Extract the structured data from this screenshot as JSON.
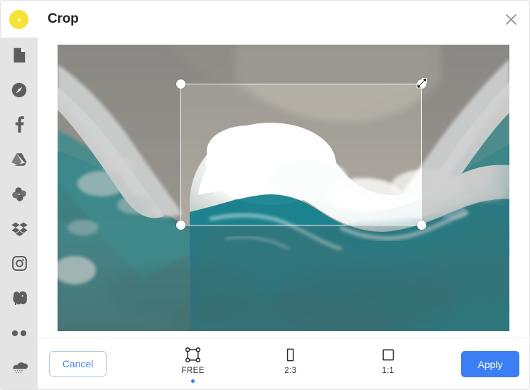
{
  "app": {
    "logo_icon": "yellow-circle-logo"
  },
  "header": {
    "title": "Crop",
    "close_icon": "close-icon"
  },
  "sidebar": {
    "items": [
      {
        "icon": "file-document-icon",
        "label": "My Computer"
      },
      {
        "icon": "compass-icon",
        "label": "Web Search"
      },
      {
        "icon": "facebook-icon",
        "label": "Facebook"
      },
      {
        "icon": "google-drive-icon",
        "label": "Google Drive"
      },
      {
        "icon": "google-photos-pinwheel-icon",
        "label": "Google Photos"
      },
      {
        "icon": "dropbox-icon",
        "label": "Dropbox"
      },
      {
        "icon": "instagram-icon",
        "label": "Instagram"
      },
      {
        "icon": "evernote-elephant-icon",
        "label": "Evernote"
      },
      {
        "icon": "flickr-dots-icon",
        "label": "Flickr"
      },
      {
        "icon": "onedrive-cloud-icon",
        "label": "OneDrive"
      }
    ]
  },
  "stage": {
    "image_alt": "Aerial view of ocean wave breaking on sandy shore",
    "crop": {
      "handles": [
        "top-left",
        "top-right",
        "bottom-left",
        "bottom-right"
      ],
      "cursor_icon": "diagonal-resize-cursor"
    }
  },
  "toolbar": {
    "cancel_label": "Cancel",
    "apply_label": "Apply",
    "ratios": [
      {
        "label": "FREE",
        "icon": "free-crop-icon",
        "selected": true
      },
      {
        "label": "2:3",
        "icon": "portrait-rect-icon",
        "selected": false
      },
      {
        "label": "1:1",
        "icon": "square-icon",
        "selected": false
      }
    ]
  },
  "colors": {
    "accent_blue": "#3c7ef3",
    "cancel_blue": "#4a86f0",
    "logo_yellow": "#f5e336",
    "sidebar_bg": "#e4e4e4",
    "icon_gray": "#6b6b6b"
  }
}
